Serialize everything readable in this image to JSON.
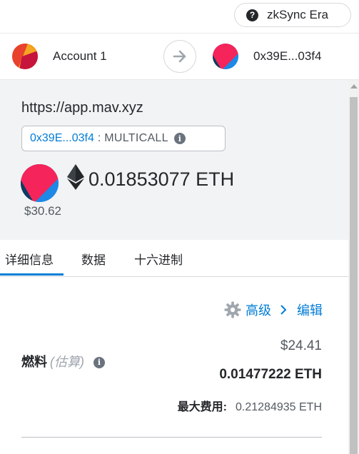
{
  "network": {
    "help_icon": "question-icon",
    "name": "zkSync Era"
  },
  "account": {
    "from_name": "Account 1",
    "to_address": "0x39E...03f4"
  },
  "summary": {
    "origin": "https://app.mav.xyz",
    "method_address": "0x39E...03f4",
    "method_separator": ":",
    "method_name": "MULTICALL",
    "amount": "0.01853077 ETH",
    "fiat": "$30.62"
  },
  "tabs": [
    {
      "label": "详细信息",
      "active": true
    },
    {
      "label": "数据",
      "active": false
    },
    {
      "label": "十六进制",
      "active": false
    }
  ],
  "fee": {
    "advanced_label": "高级",
    "edit_label": "编辑",
    "label": "燃料",
    "estimate_label": "(估算)",
    "usd": "$24.41",
    "eth": "0.01477222 ETH",
    "max_label": "最大费用:",
    "max_value": "0.21284935 ETH"
  },
  "colors": {
    "accent": "#037dd6",
    "panel": "#f2f3f4"
  }
}
